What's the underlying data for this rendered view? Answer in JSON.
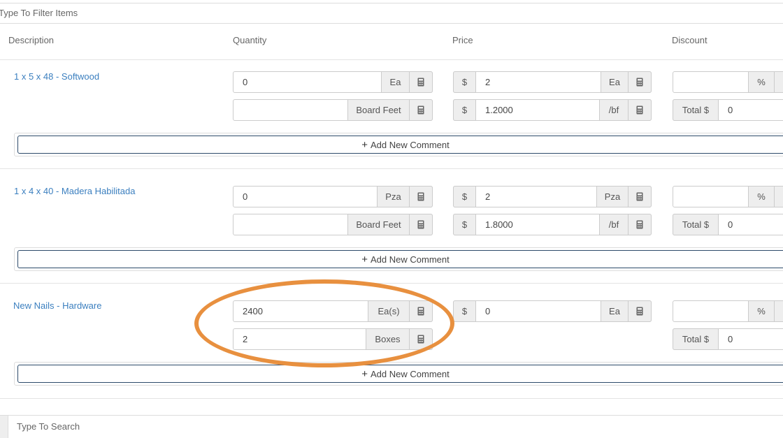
{
  "filter": {
    "placeholder": "Type To Filter Items"
  },
  "columns": {
    "description": "Description",
    "quantity": "Quantity",
    "price": "Price",
    "discount": "Discount"
  },
  "items": [
    {
      "name": "1 x 5 x 48 - Softwood",
      "qty1": {
        "value": "0",
        "unit": "Ea"
      },
      "qty2": {
        "value": "",
        "unit": "Board Feet"
      },
      "price1": {
        "symbol": "$",
        "value": "2",
        "unit": "Ea"
      },
      "price2": {
        "symbol": "$",
        "value": "1.2000",
        "unit": "/bf"
      },
      "discount": {
        "value": "",
        "unit": "%"
      },
      "total": {
        "label": "Total $",
        "value": "0"
      },
      "comment": "Add New Comment"
    },
    {
      "name": "1 x 4 x 40 - Madera Habilitada",
      "qty1": {
        "value": "0",
        "unit": "Pza"
      },
      "qty2": {
        "value": "",
        "unit": "Board Feet"
      },
      "price1": {
        "symbol": "$",
        "value": "2",
        "unit": "Pza"
      },
      "price2": {
        "symbol": "$",
        "value": "1.8000",
        "unit": "/bf"
      },
      "discount": {
        "value": "",
        "unit": "%"
      },
      "total": {
        "label": "Total $",
        "value": "0"
      },
      "comment": "Add New Comment"
    },
    {
      "name": "New Nails - Hardware",
      "qty1": {
        "value": "2400",
        "unit": "Ea(s)"
      },
      "qty2": {
        "value": "2",
        "unit": "Boxes"
      },
      "price1": {
        "symbol": "$",
        "value": "0",
        "unit": "Ea"
      },
      "discount": {
        "value": "",
        "unit": "%"
      },
      "total": {
        "label": "Total $",
        "value": "0"
      },
      "comment": "Add New Comment"
    }
  ],
  "search": {
    "placeholder": "Type To Search"
  },
  "colors": {
    "link": "#3b7fbf",
    "highlight": "#e8903f",
    "comment_border": "#2c4a6a"
  }
}
